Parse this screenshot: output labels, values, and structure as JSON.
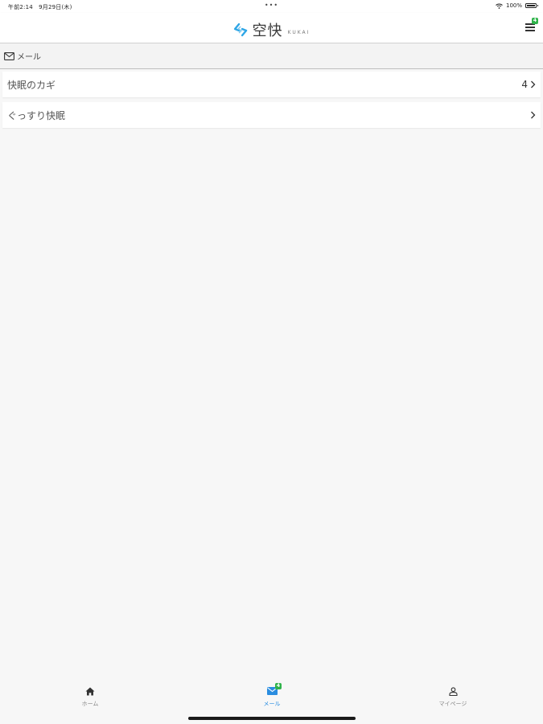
{
  "status_bar": {
    "time": "午前2:14　9月29日(木)",
    "battery": "100%"
  },
  "header": {
    "logo_name": "空快",
    "logo_sub": "KUKAI",
    "menu_badge": "4"
  },
  "section": {
    "title": "メール"
  },
  "list": {
    "items": [
      {
        "label": "快眠のカギ",
        "count": "4"
      },
      {
        "label": "ぐっすり快眠",
        "count": ""
      }
    ]
  },
  "tabs": [
    {
      "label": "ホーム",
      "active": false
    },
    {
      "label": "メール",
      "active": true,
      "badge": "4"
    },
    {
      "label": "マイページ",
      "active": false
    }
  ],
  "colors": {
    "accent": "#2a8de0",
    "badge": "#2fb34a",
    "logo": "#2ea6e6"
  }
}
